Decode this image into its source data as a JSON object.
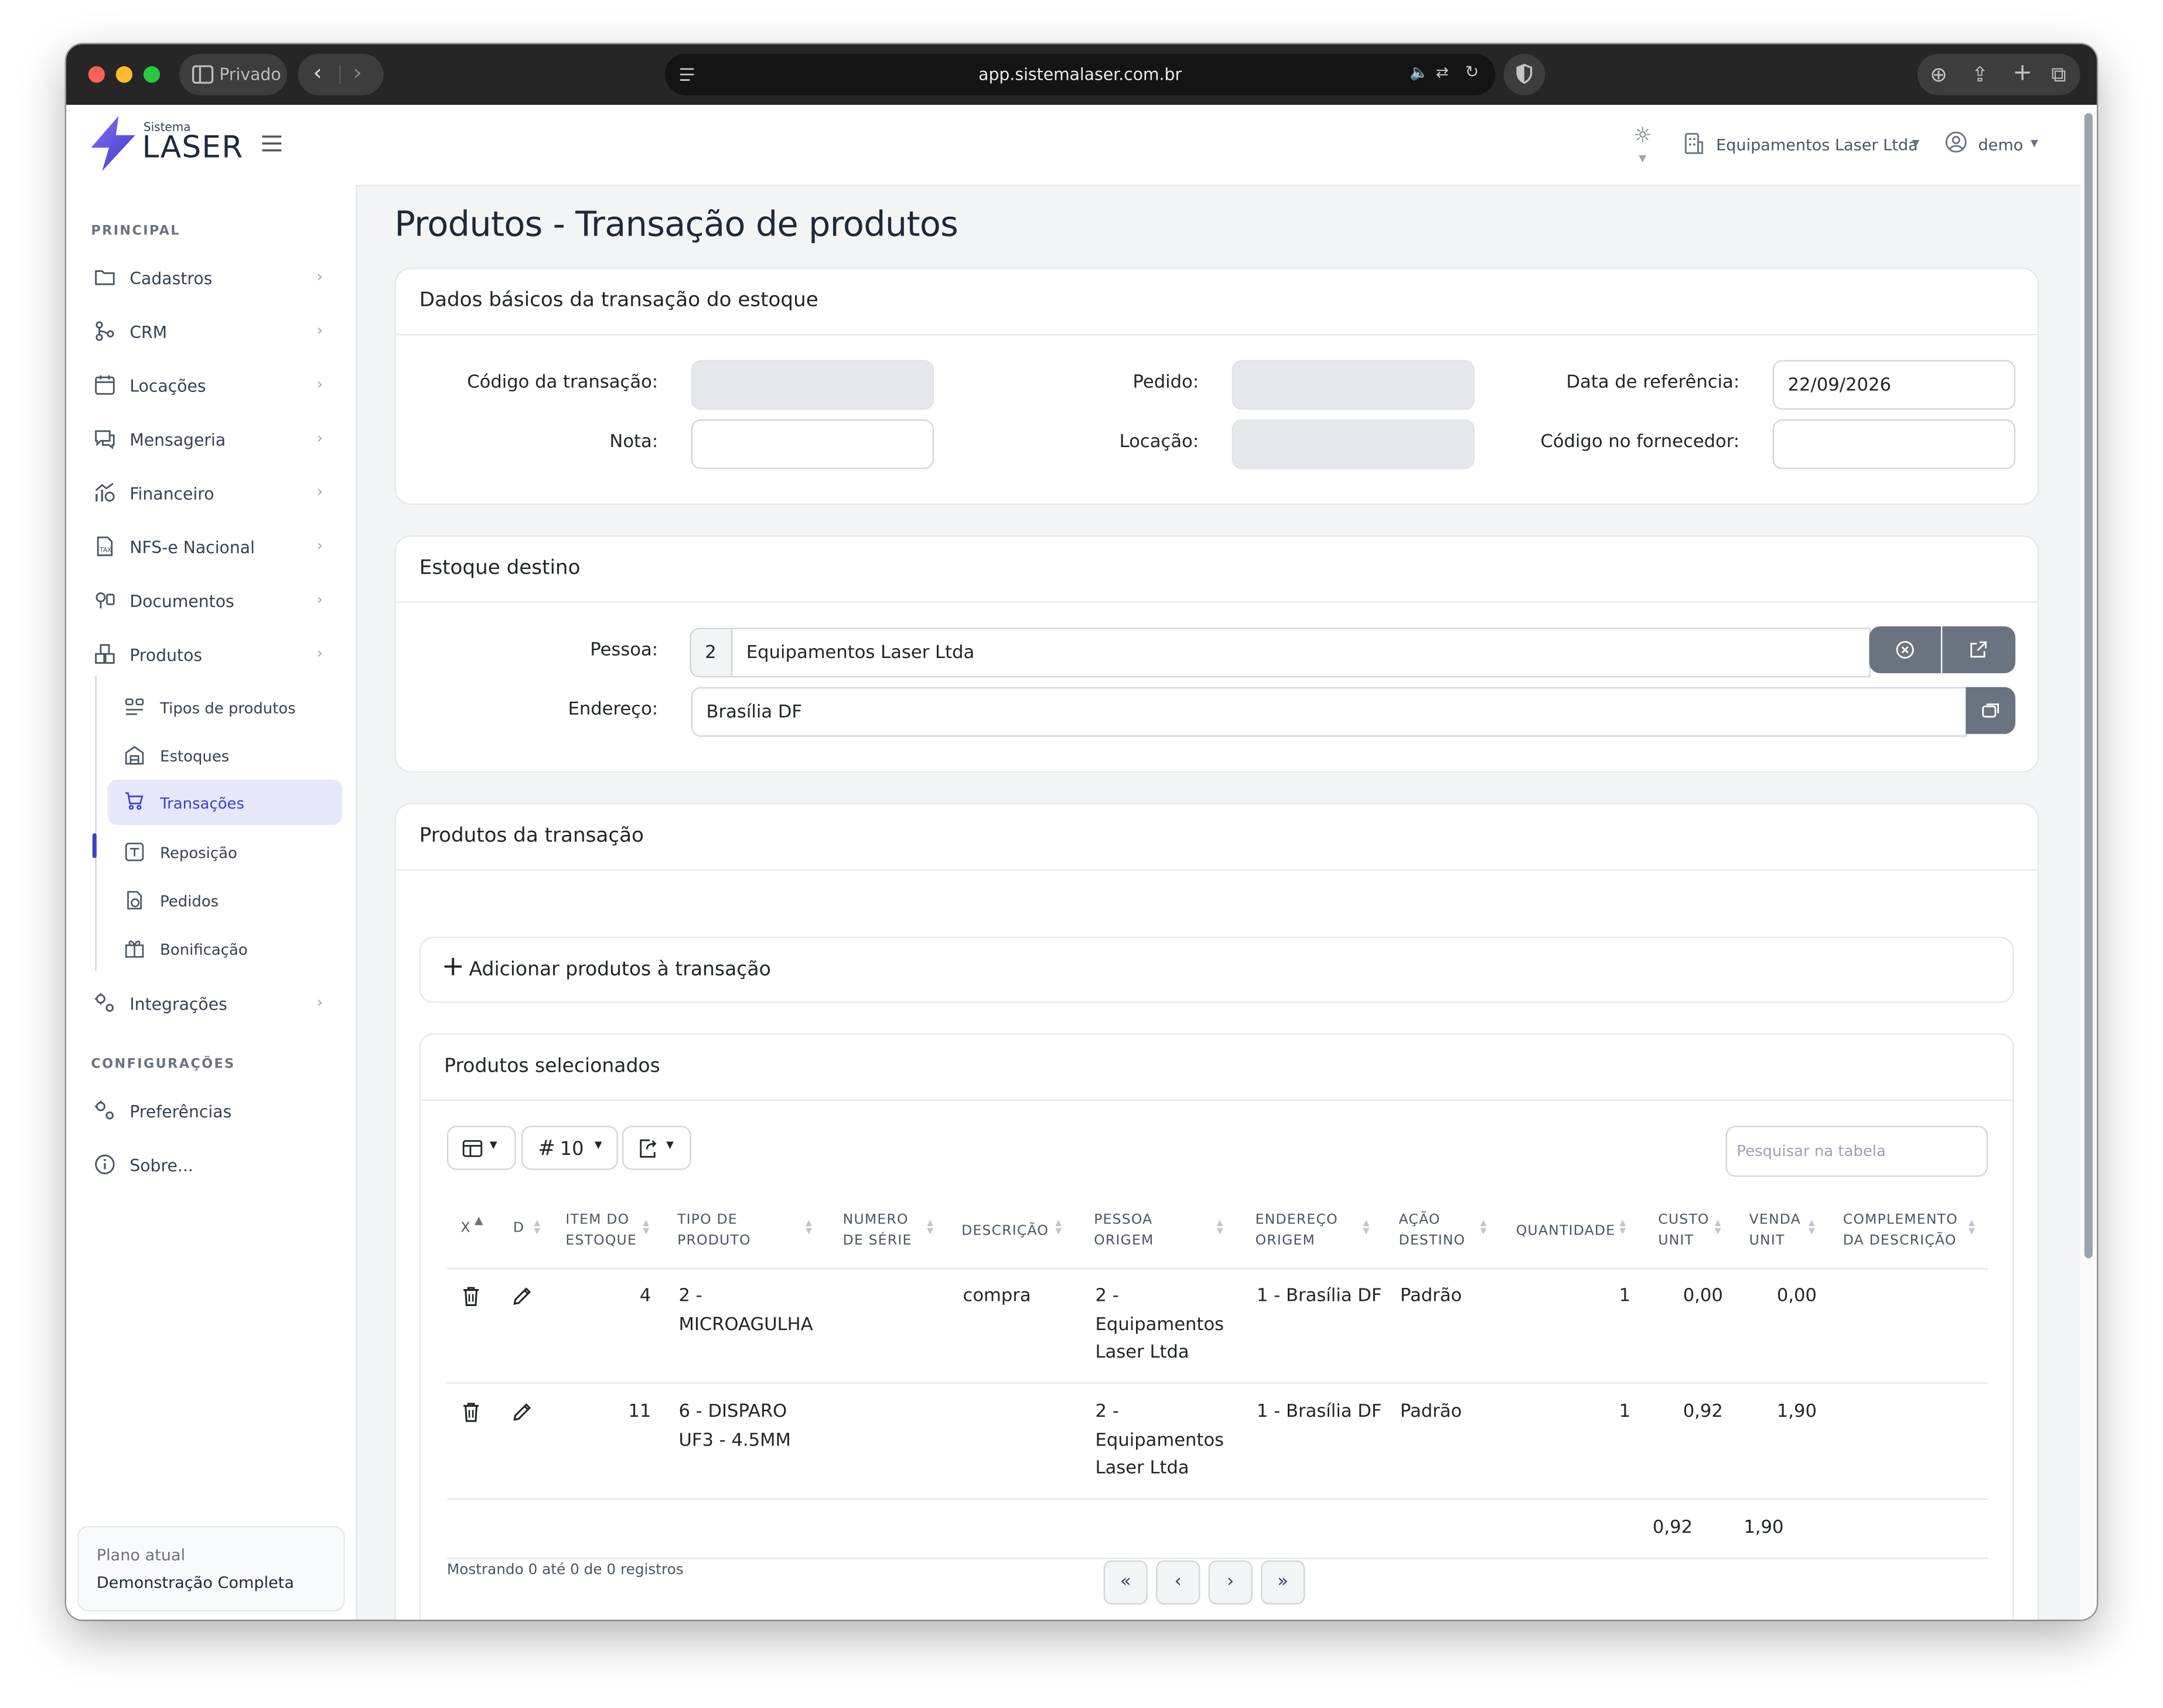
{
  "browser": {
    "private_label": "Privado",
    "url": "app.sistemalaser.com.br"
  },
  "header": {
    "logo_small": "Sistema",
    "logo_big": "LASER",
    "company": "Equipamentos Laser Ltda",
    "user": "demo"
  },
  "sidebar": {
    "section_principal": "PRINCIPAL",
    "items": [
      {
        "label": "Cadastros",
        "icon": "folder-icon"
      },
      {
        "label": "CRM",
        "icon": "crm-icon"
      },
      {
        "label": "Locações",
        "icon": "calendar-icon"
      },
      {
        "label": "Mensageria",
        "icon": "message-icon"
      },
      {
        "label": "Financeiro",
        "icon": "finance-icon"
      },
      {
        "label": "NFS-e Nacional",
        "icon": "document-tax-icon"
      },
      {
        "label": "Documentos",
        "icon": "documents-icon"
      },
      {
        "label": "Produtos",
        "icon": "box-icon"
      }
    ],
    "subitems": [
      {
        "label": "Tipos de produtos",
        "icon": "product-types-icon"
      },
      {
        "label": "Estoques",
        "icon": "warehouse-icon"
      },
      {
        "label": "Transações",
        "icon": "cart-icon",
        "active": true
      },
      {
        "label": "Reposição",
        "icon": "restock-icon"
      },
      {
        "label": "Pedidos",
        "icon": "orders-icon"
      },
      {
        "label": "Bonificação",
        "icon": "gift-icon"
      }
    ],
    "integracoes": "Integrações",
    "section_config": "CONFIGURAÇÕES",
    "preferencias": "Preferências",
    "sobre": "Sobre...",
    "plan_label": "Plano atual",
    "plan_value": "Demonstração Completa"
  },
  "page": {
    "title": "Produtos - Transação de produtos"
  },
  "basic": {
    "title": "Dados básicos da transação do estoque",
    "codigo_label": "Código da transação:",
    "codigo_value": "",
    "pedido_label": "Pedido:",
    "pedido_value": "",
    "data_label": "Data de referência:",
    "data_value": "22/09/2026",
    "nota_label": "Nota:",
    "nota_value": "",
    "locacao_label": "Locação:",
    "locacao_value": "",
    "fornecedor_label": "Código no fornecedor:",
    "fornecedor_value": ""
  },
  "destino": {
    "title": "Estoque destino",
    "pessoa_label": "Pessoa:",
    "pessoa_id": "2",
    "pessoa_nome": "Equipamentos Laser Ltda",
    "endereco_label": "Endereço:",
    "endereco_value": "Brasília DF"
  },
  "produtos": {
    "title": "Produtos da transação",
    "add_label": "Adicionar produtos à transação",
    "selected_title": "Produtos selecionados",
    "page_size": "10",
    "search_placeholder": "Pesquisar na tabela",
    "columns": [
      {
        "line1": "X",
        "line2": ""
      },
      {
        "line1": "D",
        "line2": ""
      },
      {
        "line1": "ITEM DO",
        "line2": "ESTOQUE"
      },
      {
        "line1": "TIPO DE",
        "line2": "PRODUTO"
      },
      {
        "line1": "NUMERO",
        "line2": "DE SÉRIE"
      },
      {
        "line1": "DESCRIÇÃO",
        "line2": ""
      },
      {
        "line1": "PESSOA",
        "line2": "ORIGEM"
      },
      {
        "line1": "ENDEREÇO",
        "line2": "ORIGEM"
      },
      {
        "line1": "AÇÃO",
        "line2": "DESTINO"
      },
      {
        "line1": "QUANTIDADE",
        "line2": ""
      },
      {
        "line1": "CUSTO",
        "line2": "UNIT"
      },
      {
        "line1": "VENDA",
        "line2": "UNIT"
      },
      {
        "line1": "COMPLEMENTO",
        "line2": "DA DESCRIÇÃO"
      }
    ],
    "rows": [
      {
        "item": "4",
        "tipo": [
          "2 -",
          "MICROAGULHA"
        ],
        "serie": "",
        "descricao": "compra",
        "pessoa": [
          "2 -",
          "Equipamentos",
          "Laser Ltda"
        ],
        "endereco": "1 - Brasília DF",
        "acao": "Padrão",
        "quantidade": "1",
        "custo": "0,00",
        "venda": "0,00",
        "complemento": ""
      },
      {
        "item": "11",
        "tipo": [
          "6 - DISPARO",
          "UF3 - 4.5MM"
        ],
        "serie": "",
        "descricao": "",
        "pessoa": [
          "2 -",
          "Equipamentos",
          "Laser Ltda"
        ],
        "endereco": "1 - Brasília DF",
        "acao": "Padrão",
        "quantidade": "1",
        "custo": "0,92",
        "venda": "1,90",
        "complemento": ""
      }
    ],
    "totals": {
      "custo": "0,92",
      "venda": "1,90"
    },
    "info": "Mostrando 0 até 0 de 0 registros",
    "pagination": {
      "first": "«",
      "prev": "‹",
      "next": "›",
      "last": "»"
    }
  }
}
